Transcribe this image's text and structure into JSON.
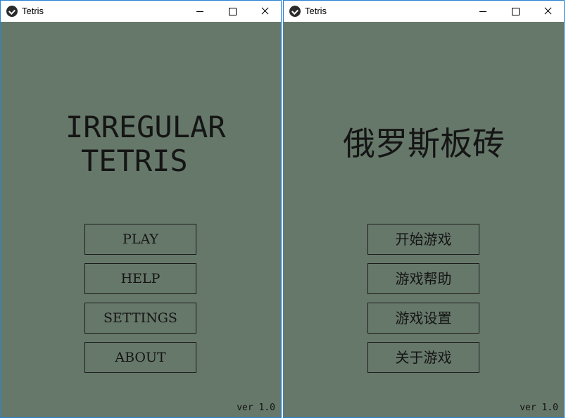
{
  "colors": {
    "client_bg": "#66786a",
    "ink": "#151515",
    "window_border": "#2b83d4"
  },
  "windows": [
    {
      "title": "Tetris",
      "icon": "kivy-app-icon",
      "logo_lines": [
        "IRREGULAR",
        "TETRIS"
      ],
      "buttons": [
        "PLAY",
        "HELP",
        "SETTINGS",
        "ABOUT"
      ],
      "version": "ver 1.0"
    },
    {
      "title": "Tetris",
      "icon": "kivy-app-icon",
      "logo_text": "俄罗斯板砖",
      "buttons": [
        "开始游戏",
        "游戏帮助",
        "游戏设置",
        "关于游戏"
      ],
      "version": "ver 1.0"
    }
  ]
}
